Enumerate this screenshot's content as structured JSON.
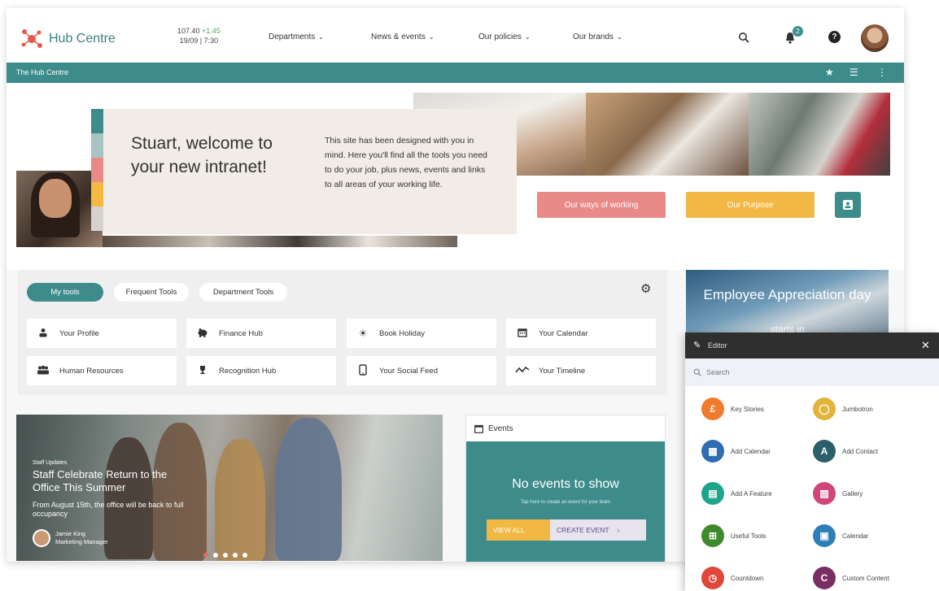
{
  "header": {
    "logo_text": "Hub Centre",
    "stock_value": "107.40",
    "stock_change": "+1.45",
    "stock_time": "19/09 | 7:30",
    "nav": [
      {
        "label": "Departments"
      },
      {
        "label": "News & events"
      },
      {
        "label": "Our policies"
      },
      {
        "label": "Our brands"
      }
    ],
    "notification_count": "2",
    "help_symbol": "?"
  },
  "site_bar": {
    "title": "The Hub Centre"
  },
  "hero": {
    "welcome_title": "Stuart, welcome to your new intranet!",
    "welcome_text": "This site has been designed with you in mind. Here you'll find all the tools you need to do your job, plus news, events and links to all areas of your working life.",
    "stripe_colors": [
      "#3e8b8c",
      "#a7c4c2",
      "#e98a87",
      "#f3b942",
      "#d6d2ce"
    ],
    "buttons": [
      {
        "label": "Our ways of working",
        "color": "#e88a88"
      },
      {
        "label": "Our Purpose",
        "color": "#f1b843"
      }
    ]
  },
  "tools": {
    "tabs": [
      {
        "label": "My tools",
        "active": true
      },
      {
        "label": "Frequent Tools",
        "active": false
      },
      {
        "label": "Department Tools",
        "active": false
      }
    ],
    "items": [
      {
        "label": "Your Profile",
        "icon": "person-icon",
        "glyph": "👤"
      },
      {
        "label": "Finance Hub",
        "icon": "piggy-bank-icon",
        "glyph": "🐷"
      },
      {
        "label": "Book Holiday",
        "icon": "sun-icon",
        "glyph": "☀"
      },
      {
        "label": "Your Calendar",
        "icon": "calendar-icon",
        "glyph": "▦"
      },
      {
        "label": "Human Resources",
        "icon": "people-icon",
        "glyph": "👥"
      },
      {
        "label": "Recognition Hub",
        "icon": "trophy-icon",
        "glyph": "🏆"
      },
      {
        "label": "Your Social Feed",
        "icon": "phone-icon",
        "glyph": "▯"
      },
      {
        "label": "Your Timeline",
        "icon": "timeline-icon",
        "glyph": "〰"
      }
    ]
  },
  "news": {
    "kicker": "Staff Updates",
    "title": "Staff Celebrate Return to the Office This Summer",
    "description": "From August 15th, the office will be back to full occupancy",
    "author_name": "Jamie King",
    "author_role": "Marketing Manager",
    "slide_count": 5,
    "active_slide": 0
  },
  "events": {
    "title": "Events",
    "empty_text": "No events to show",
    "sub_text": "Tap here to create an event for your team",
    "view_all": "VIEW ALL",
    "create_event": "CREATE EVENT"
  },
  "appreciation": {
    "title": "Employee Appreciation day",
    "subtitle": "starts in"
  },
  "panel": {
    "title": "Editor",
    "search_placeholder": "Search",
    "widgets": [
      {
        "label": "Key Stories",
        "letter": "£",
        "color": "#f07b2d"
      },
      {
        "label": "Jumbotron",
        "letter": "◯",
        "color": "#e3b43c"
      },
      {
        "label": "Add Calendar",
        "letter": "▦",
        "color": "#2f6db3"
      },
      {
        "label": "Add Contact",
        "letter": "A",
        "color": "#2c5f6a"
      },
      {
        "label": "Add A Feature",
        "letter": "▤",
        "color": "#1fa38a"
      },
      {
        "label": "Gallery",
        "letter": "▨",
        "color": "#d0457a"
      },
      {
        "label": "Useful Tools",
        "letter": "⊞",
        "color": "#3f8b2c"
      },
      {
        "label": "Calendar",
        "letter": "▣",
        "color": "#2e7fb6"
      },
      {
        "label": "Countdown",
        "letter": "◷",
        "color": "#e0463a"
      },
      {
        "label": "Custom Content",
        "letter": "C",
        "color": "#7a2f62"
      }
    ]
  }
}
